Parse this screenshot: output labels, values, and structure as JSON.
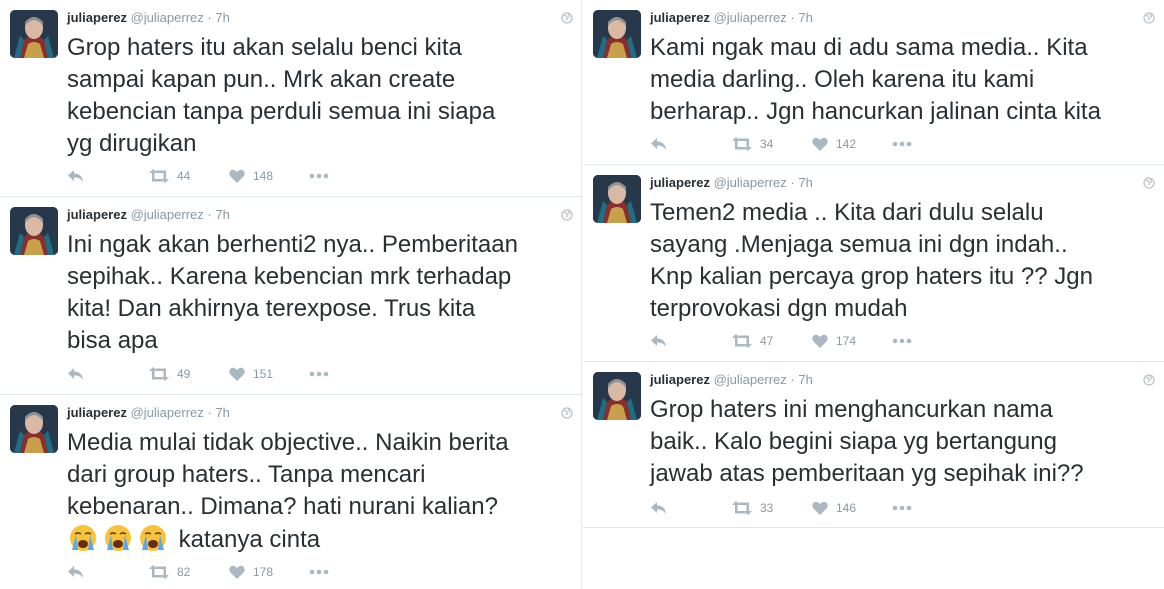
{
  "colors": {
    "text": "#292f33",
    "muted": "#8899a6",
    "divider": "#e1e8ed"
  },
  "icons": {
    "reply": "reply-icon",
    "retweet": "retweet-icon",
    "like": "heart-icon",
    "more": "more-icon",
    "globe": "globe-icon"
  },
  "left_column": [
    {
      "name": "juliaperez",
      "handle": "@juliaperrez",
      "sep": "·",
      "time": "7h",
      "lines": [
        "Grop haters itu akan selalu benci kita",
        "sampai kapan pun.. Mrk akan create",
        "kebencian tanpa perduli semua ini siapa",
        "yg dirugikan"
      ],
      "retweets": "44",
      "likes": "148"
    },
    {
      "name": "juliaperez",
      "handle": "@juliaperrez",
      "sep": "·",
      "time": "7h",
      "lines": [
        "Ini ngak akan berhenti2 nya.. Pemberitaan",
        "sepihak.. Karena kebencian mrk terhadap",
        "kita! Dan akhirnya terexpose. Trus kita",
        "bisa apa"
      ],
      "retweets": "49",
      "likes": "151"
    },
    {
      "name": "juliaperez",
      "handle": "@juliaperrez",
      "sep": "·",
      "time": "7h",
      "lines": [
        "Media mulai tidak objective.. Naikin berita",
        "dari group haters.. Tanpa mencari",
        "kebenaran.. Dimana? hati nurani kalian?"
      ],
      "last_line_text": "katanya cinta",
      "retweets": "82",
      "likes": "178"
    }
  ],
  "right_column": [
    {
      "name": "juliaperez",
      "handle": "@juliaperrez",
      "sep": "·",
      "time": "7h",
      "lines": [
        "Kami ngak mau di adu sama media.. Kita",
        "media darling.. Oleh karena itu kami",
        "berharap.. Jgn hancurkan jalinan cinta kita"
      ],
      "retweets": "34",
      "likes": "142"
    },
    {
      "name": "juliaperez",
      "handle": "@juliaperrez",
      "sep": "·",
      "time": "7h",
      "lines": [
        "Temen2 media .. Kita dari dulu selalu",
        "sayang .Menjaga semua ini dgn indah..",
        "Knp kalian percaya grop haters itu ?? Jgn",
        "terprovokasi dgn mudah"
      ],
      "retweets": "47",
      "likes": "174"
    },
    {
      "name": "juliaperez",
      "handle": "@juliaperrez",
      "sep": "·",
      "time": "7h",
      "lines": [
        "Grop haters ini menghancurkan nama",
        "baik.. Kalo begini siapa yg bertangung",
        "jawab atas pemberitaan yg sepihak ini??"
      ],
      "retweets": "33",
      "likes": "146"
    }
  ]
}
